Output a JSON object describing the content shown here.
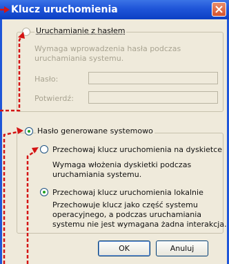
{
  "window": {
    "title": "Klucz uruchomienia"
  },
  "password_option": {
    "label": "Uruchamianie z hasłem",
    "description_line1": "Wymaga wprowadzenia hasła podczas",
    "description_line2": "uruchamiania systemu.",
    "password_label": "Hasło:",
    "confirm_label": "Potwierdź:",
    "password_value": "",
    "confirm_value": ""
  },
  "system_option": {
    "label": "Hasło generowane systemowo",
    "floppy": {
      "label": "Przechowaj klucz uruchomienia na dyskietce",
      "desc_line1": "Wymaga włożenia dyskietki podczas",
      "desc_line2": "uruchamiania systemu."
    },
    "local": {
      "label": "Przechowaj klucz uruchomienia lokalnie",
      "desc_line1": "Przechowuje klucz jako część systemu",
      "desc_line2": "operacyjnego, a podczas uruchamiania",
      "desc_line3": "systemu nie jest wymagana żadna interakcja."
    }
  },
  "buttons": {
    "ok": "OK",
    "cancel": "Anuluj"
  },
  "colors": {
    "title_bar": "#1f55d8",
    "annotation": "#d41414",
    "dialog_bg": "#efeadb"
  },
  "icons": {
    "close": "close-icon"
  }
}
